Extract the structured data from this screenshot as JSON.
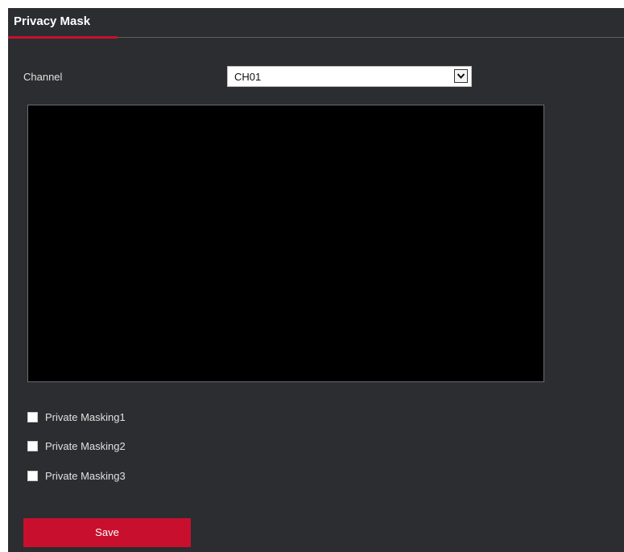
{
  "tab": {
    "title": "Privacy Mask"
  },
  "channel": {
    "label": "Channel",
    "selected": "CH01",
    "arrow_icon": "chevron-down-icon"
  },
  "masks": [
    {
      "label": "Private Masking1",
      "checked": false
    },
    {
      "label": "Private Masking2",
      "checked": false
    },
    {
      "label": "Private Masking3",
      "checked": false
    }
  ],
  "actions": {
    "save_label": "Save"
  },
  "colors": {
    "accent": "#c8102e",
    "panel_bg": "#2b2d30",
    "preview_bg": "#000000"
  }
}
